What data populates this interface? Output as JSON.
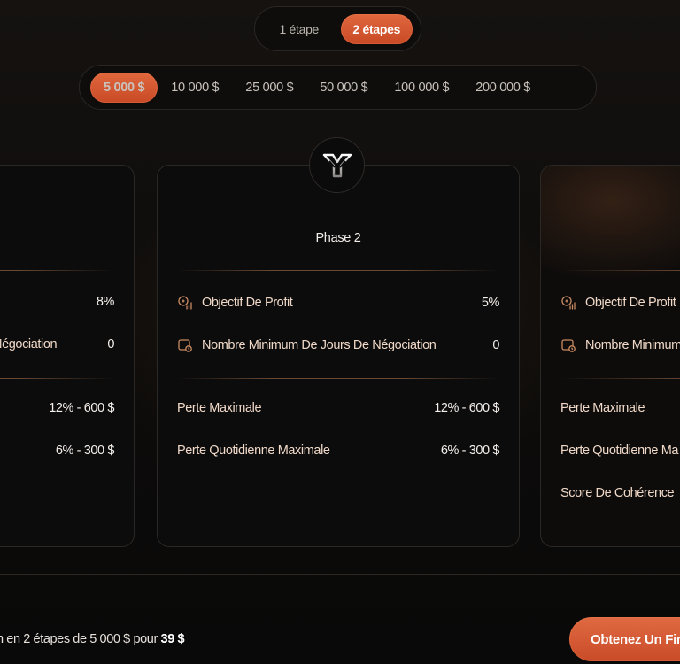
{
  "step_toggle": {
    "options": [
      "1 étape",
      "2 étapes"
    ],
    "selected": "2 étapes"
  },
  "account_sizes": {
    "options": [
      "5 000 $",
      "10 000 $",
      "25 000 $",
      "50 000 $",
      "100 000 $",
      "200 000 $"
    ],
    "selected": "5 000 $"
  },
  "cards": {
    "left": {
      "rows": [
        {
          "label": "",
          "value": "8%"
        },
        {
          "label": "Négociation",
          "value": "0"
        },
        {
          "label": "",
          "value": "12% - 600 $"
        },
        {
          "label": "",
          "value": "6% - 300 $"
        }
      ]
    },
    "center": {
      "title": "Phase 2",
      "profit_target": {
        "label": "Objectif De Profit",
        "value": "5%"
      },
      "min_days": {
        "label": "Nombre Minimum De Jours De Négociation",
        "value": "0"
      },
      "max_loss": {
        "label": "Perte Maximale",
        "value": "12% - 600 $"
      },
      "max_daily_loss": {
        "label": "Perte Quotidienne Maximale",
        "value": "6% - 300 $"
      }
    },
    "right": {
      "profit_target": {
        "label": "Objectif De Profit"
      },
      "min_days": {
        "label": "Nombre Minimum"
      },
      "max_loss": {
        "label": "Perte Maximale"
      },
      "max_daily_loss": {
        "label": "Perte Quotidienne Ma"
      },
      "consistency": {
        "label": "Score De Cohérence"
      }
    }
  },
  "summary": {
    "text": "n en 2 étapes de 5 000 $ pour ",
    "price": "39 $"
  },
  "cta": {
    "label": "Obtenez Un Fina"
  },
  "colors": {
    "accent": "#d9582f",
    "card_bg": "#0d0c0c",
    "label": "#f0d9c8"
  },
  "icons": {
    "logo": "brand-logo-icon",
    "profit": "coin-chart-icon",
    "days": "calendar-clock-icon"
  }
}
